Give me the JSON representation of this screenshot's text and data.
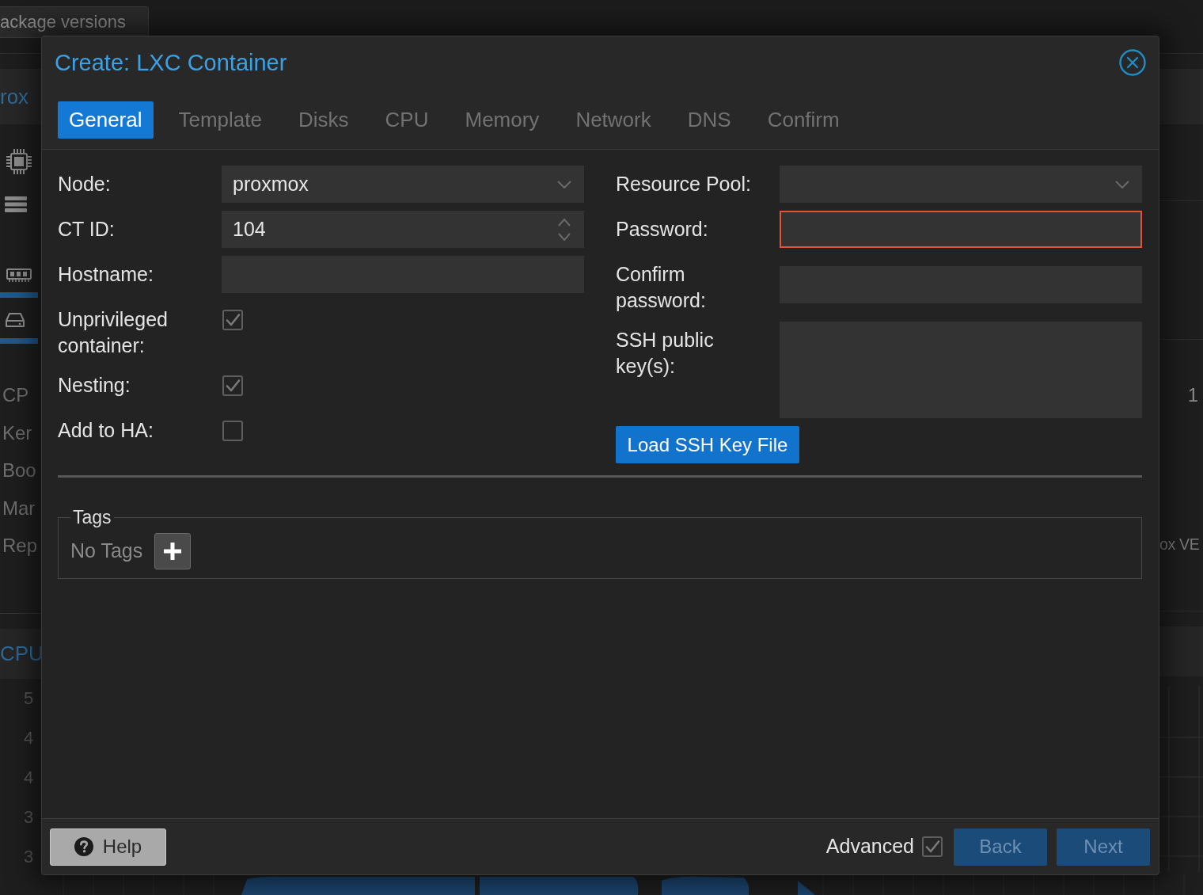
{
  "background": {
    "tab_button": "ackage versions",
    "node_header": "rox",
    "summary_labels": [
      "CP",
      "Ker",
      "Boo",
      "Mar",
      "Rep"
    ],
    "chart_panel_title": "CPU",
    "axis_labels": [
      "5",
      "4",
      "4",
      "3",
      "3"
    ],
    "right_value": "1",
    "right_title": "ox VE"
  },
  "dialog": {
    "title": "Create: LXC Container",
    "tabs": [
      {
        "label": "General",
        "selected": true
      },
      {
        "label": "Template",
        "selected": false
      },
      {
        "label": "Disks",
        "selected": false
      },
      {
        "label": "CPU",
        "selected": false
      },
      {
        "label": "Memory",
        "selected": false
      },
      {
        "label": "Network",
        "selected": false
      },
      {
        "label": "DNS",
        "selected": false
      },
      {
        "label": "Confirm",
        "selected": false
      }
    ],
    "left_fields": [
      {
        "kind": "combo",
        "label": "Node:",
        "value": "proxmox"
      },
      {
        "kind": "spinner",
        "label": "CT ID:",
        "value": "104"
      },
      {
        "kind": "text",
        "label": "Hostname:"
      },
      {
        "kind": "checkbox",
        "label": "Unprivileged container:",
        "checked": true
      },
      {
        "kind": "checkbox",
        "label": "Nesting:",
        "checked": true
      },
      {
        "kind": "checkbox",
        "label": "Add to HA:",
        "checked": false
      }
    ],
    "right_fields": [
      {
        "kind": "combo",
        "label": "Resource Pool:",
        "invalid": false
      },
      {
        "kind": "password",
        "label": "Password:",
        "invalid": true
      },
      {
        "kind": "password",
        "label": "Confirm password:",
        "invalid": false
      },
      {
        "kind": "textarea",
        "label": "SSH public key(s):",
        "invalid": false
      }
    ],
    "load_button": "Load SSH Key File",
    "tags": {
      "legend": "Tags",
      "empty_text": "No Tags"
    },
    "footer": {
      "help": "Help",
      "advanced": {
        "label": "Advanced",
        "checked": true
      },
      "buttons": [
        {
          "label": "Back",
          "disabled": true
        },
        {
          "label": "Next",
          "disabled": true
        }
      ]
    }
  }
}
